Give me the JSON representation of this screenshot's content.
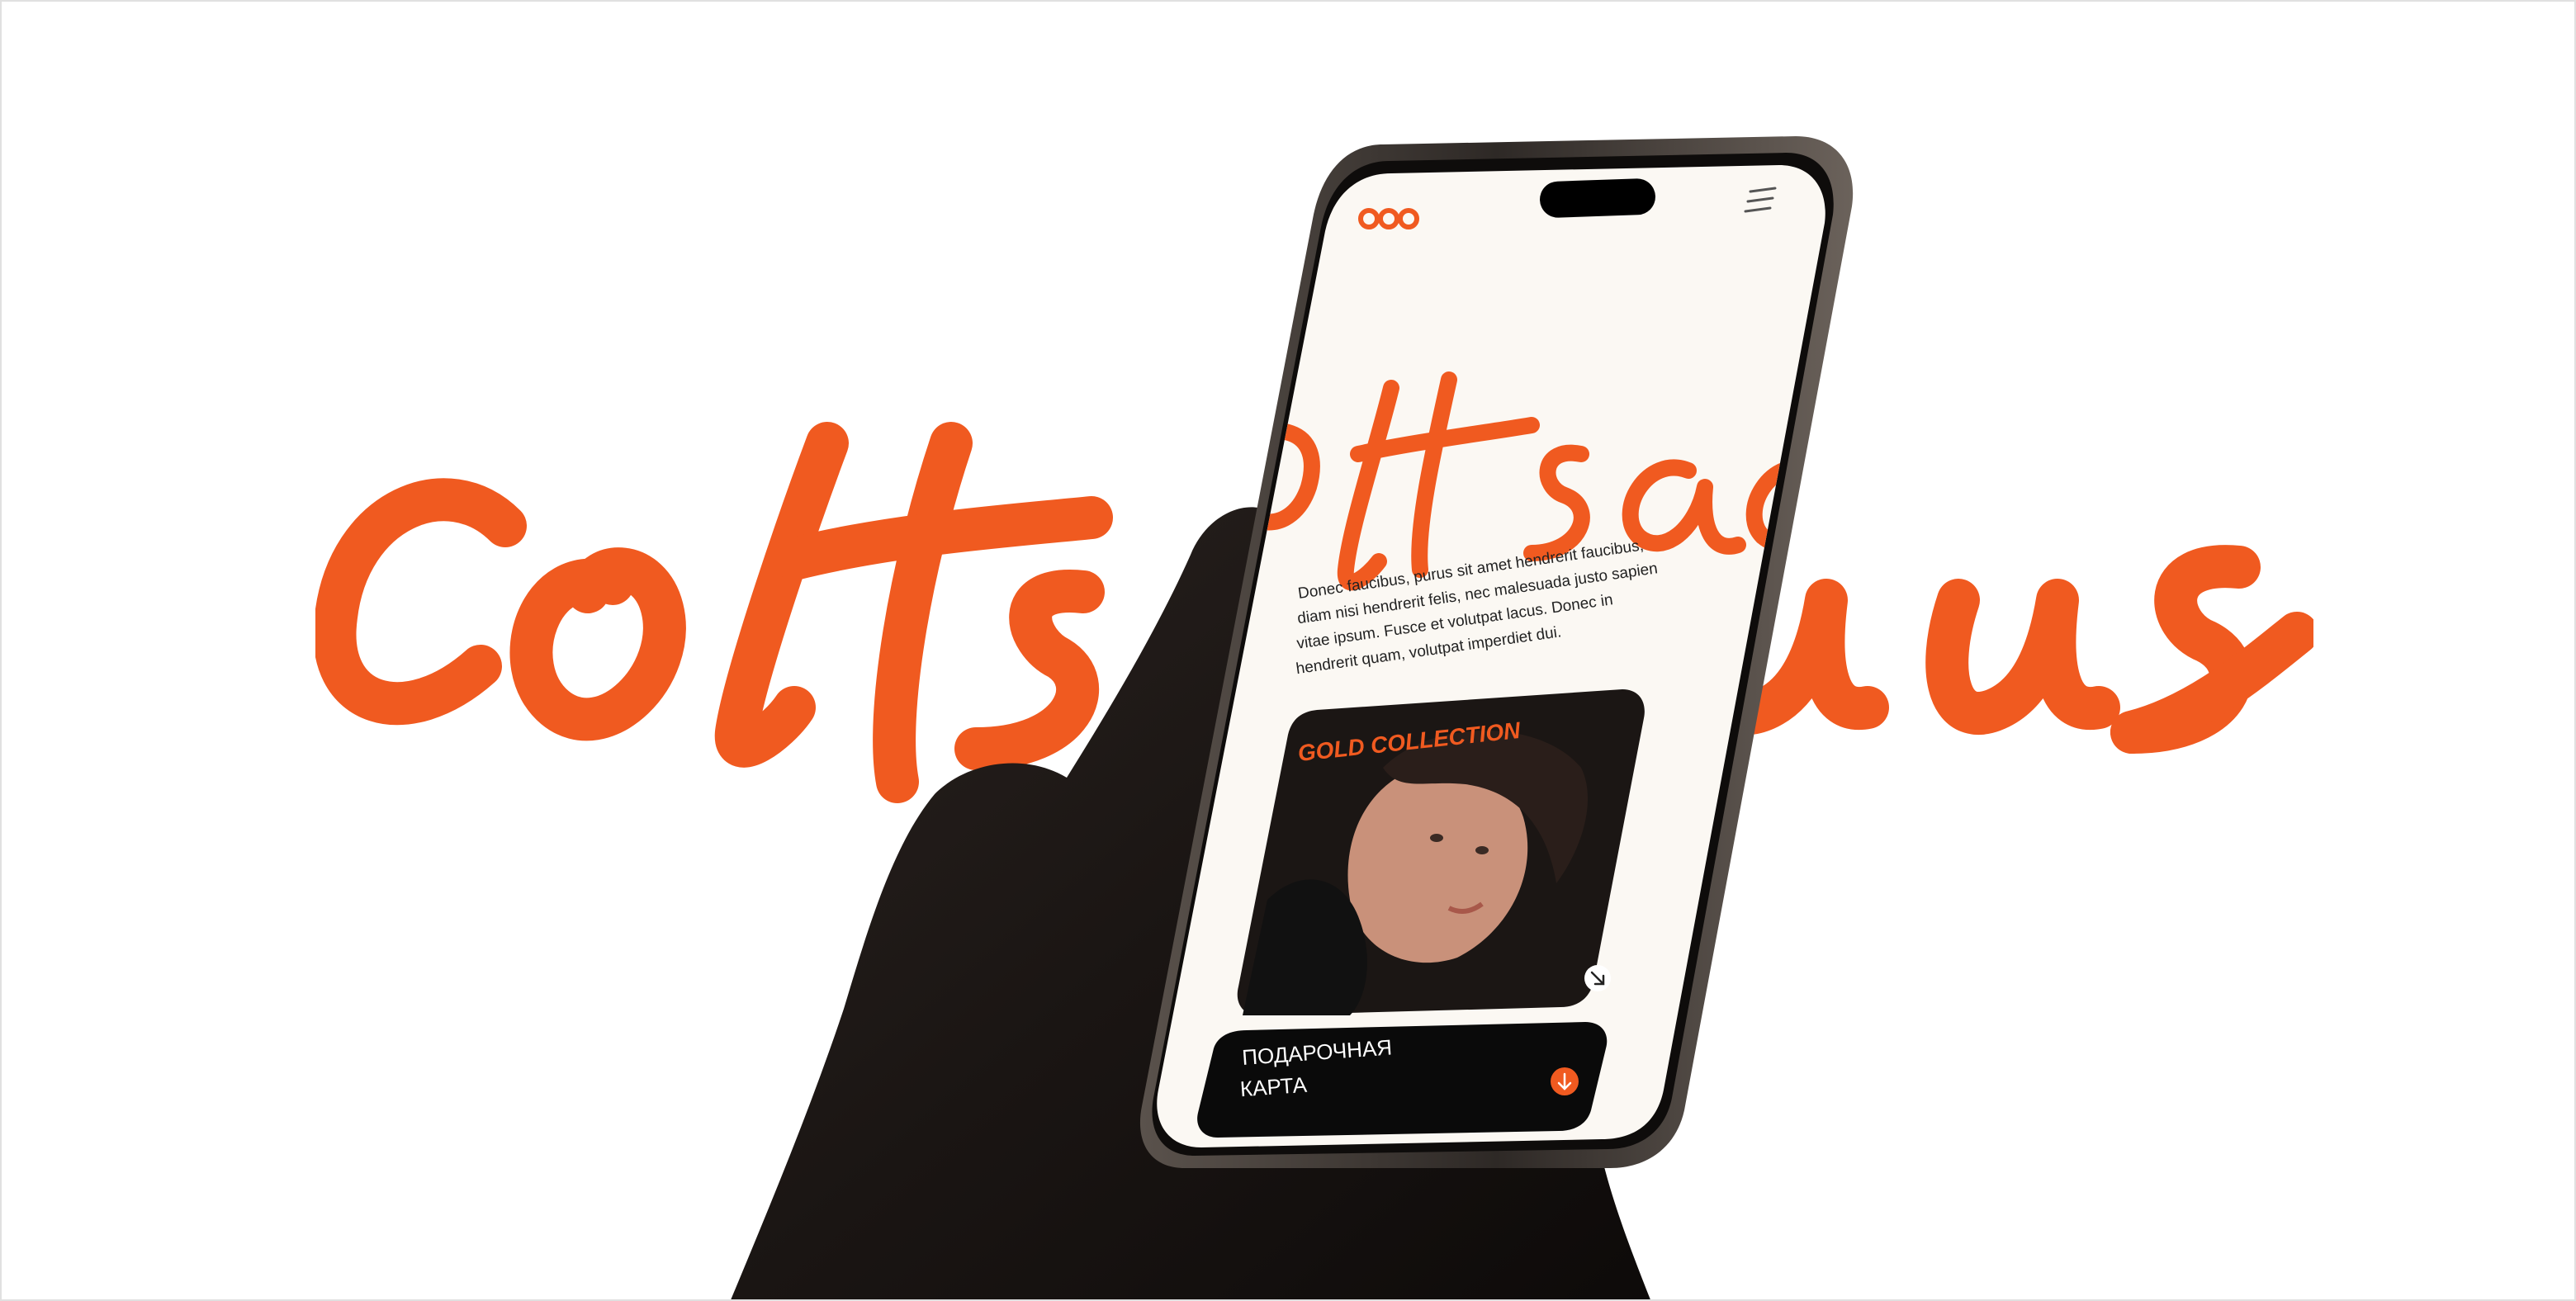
{
  "brand": {
    "word": "coltsalus",
    "accent_color": "#F05A20",
    "logo_icon": "three-circles-logo-icon"
  },
  "phone_screen": {
    "screen_script_word": "oltsaa",
    "body_text_lines": [
      "Donec faucibus, purus sit amet hendrerit faucibus,",
      "diam nisi hendrerit felis, nec malesuada justo sapien",
      "vitae ipsum. Fusce et volutpat lacus. Donec in",
      "hendrerit quam, volutpat imperdiet dui."
    ],
    "collection_card": {
      "title": "GOLD COLLECTION",
      "arrow_icon": "arrow-down-right-icon"
    },
    "gift_card": {
      "line1": "ПОДАРОЧНАЯ",
      "line2": "КАРТА",
      "arrow_icon": "arrow-down-circle-icon"
    },
    "menu_icon": "hamburger-menu-icon"
  },
  "colors": {
    "background": "#FFFFFF",
    "accent": "#F05A20",
    "screen_bg": "#FBF8F3",
    "phone_frame": "#3A3430",
    "gift_card_bg": "#0A0A0A"
  }
}
